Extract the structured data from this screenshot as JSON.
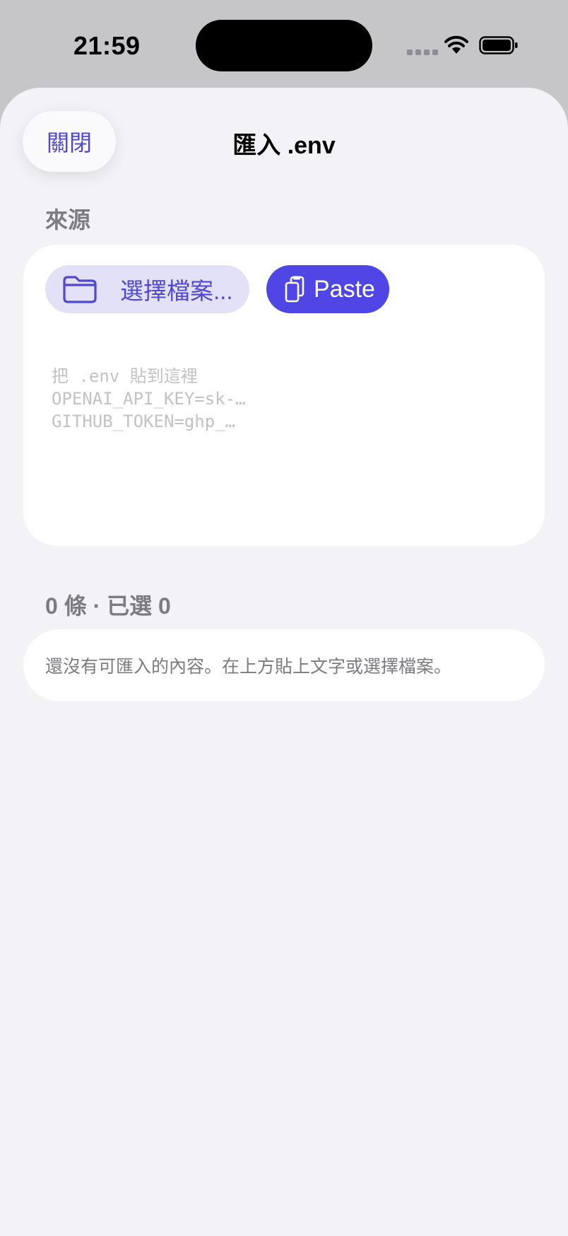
{
  "status_bar": {
    "time": "21:59"
  },
  "header": {
    "close_label": "關閉",
    "title": "匯入 .env"
  },
  "source": {
    "section_label": "來源",
    "choose_file_label": "選擇檔案...",
    "paste_label": "Paste",
    "textarea_placeholder": "把 .env 貼到這裡\nOPENAI_API_KEY=sk-…\nGITHUB_TOKEN=ghp_…",
    "textarea_value": ""
  },
  "entries": {
    "count_label": "0 條 · 已選 0",
    "empty_message": "還沒有可匯入的內容。在上方貼上文字或選擇檔案。"
  },
  "icons": {
    "close": "none",
    "choose_file": "folder-icon",
    "paste": "paste-icon",
    "wifi": "wifi-icon",
    "battery": "battery-icon"
  },
  "colors": {
    "accent": "#4f46e5",
    "accent_text": "#5048d2",
    "accent_tint": "#e2e1f8",
    "secondary_text": "#7c7c80",
    "sheet_background": "#f2f2f7"
  }
}
